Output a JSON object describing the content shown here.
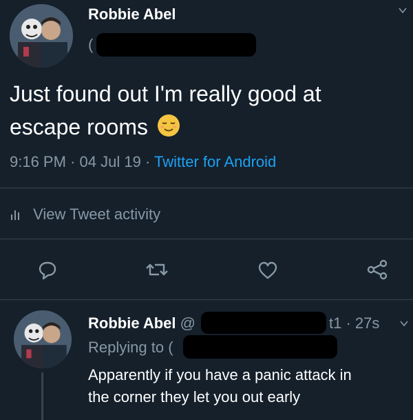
{
  "tweet": {
    "author_name": "Robbie Abel",
    "handle_prefix": "(",
    "text_line1": "Just found out I'm really good at",
    "text_line2": "escape rooms",
    "emoji": "😌",
    "time": "9:16 PM",
    "sep1": "·",
    "date": "04 Jul 19",
    "sep2": "·",
    "source": "Twitter for Android",
    "activity_label": "View Tweet activity"
  },
  "reply": {
    "author_name": "Robbie Abel",
    "handle_prefix": "@",
    "time_suffix": "t1 · 27s",
    "replying_to_label": "Replying to",
    "replying_prefix": "(",
    "text_line1": "Apparently if you have a panic attack in",
    "text_line2": "the corner they let you out early"
  },
  "colors": {
    "background": "#15202b",
    "accent": "#1da1f2",
    "muted": "#8899a6",
    "divider": "#38444d"
  },
  "icons": [
    "chevron-down-icon",
    "bar-chart-icon",
    "reply-icon",
    "retweet-icon",
    "like-icon",
    "share-icon"
  ]
}
